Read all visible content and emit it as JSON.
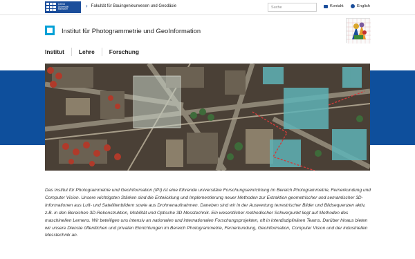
{
  "topbar": {
    "uni_logo_text": [
      "Leibniz",
      "Universität",
      "Hannover"
    ],
    "faculty_link": "Fakultät für Bauingenieurwesen und Geodäsie",
    "search_placeholder": "Suche",
    "contact_label": "Kontakt",
    "language_label": "English",
    "icons": {
      "faculty_link": "chevron-right-icon",
      "contact": "mail-icon",
      "language": "globe-icon"
    }
  },
  "header": {
    "institute_title": "Institut für Photogrammetrie und GeoInformation"
  },
  "nav": {
    "items": [
      "Institut",
      "Lehre",
      "Forschung"
    ]
  },
  "colors": {
    "brand_blue": "#0e4f9c",
    "logo_cyan": "#00a0d6"
  },
  "intro": {
    "text": "Das Institut für Photogrammetrie und GeoInformation (IPI) ist eine führende universitäre Forschungseinrichtung im Bereich Photogrammetrie, Fernerkundung und Computer Vision. Unsere wichtigsten Stärken sind die Entwicklung und Implementierung neuer Methoden zur Extraktion geometrischer und semantischer 3D-Informationen aus Luft- und Satellitenbildern sowie aus Drohnenaufnahmen. Daneben sind wir in der Auswertung terrestrischer Bilder und Bildsequenzen aktiv, z.B. in den Bereichen 3D-Rekonstruktion, Mobilität und Optische 3D Messtechnik. Ein wesentlicher methodischer Schwerpunkt liegt auf Methoden des maschinellen Lernens. Wir beteiligen uns intensiv an nationalen und internationalen Forschungsprojekten, oft in interdisziplinären Teams. Darüber hinaus bieten wir unsere Dienste öffentlichen und privaten Einrichtungen im Bereich Photogrammetrie, Fernerkundung, Geoinformation, Computer Vision und der industriellen Messtechnik an."
  }
}
